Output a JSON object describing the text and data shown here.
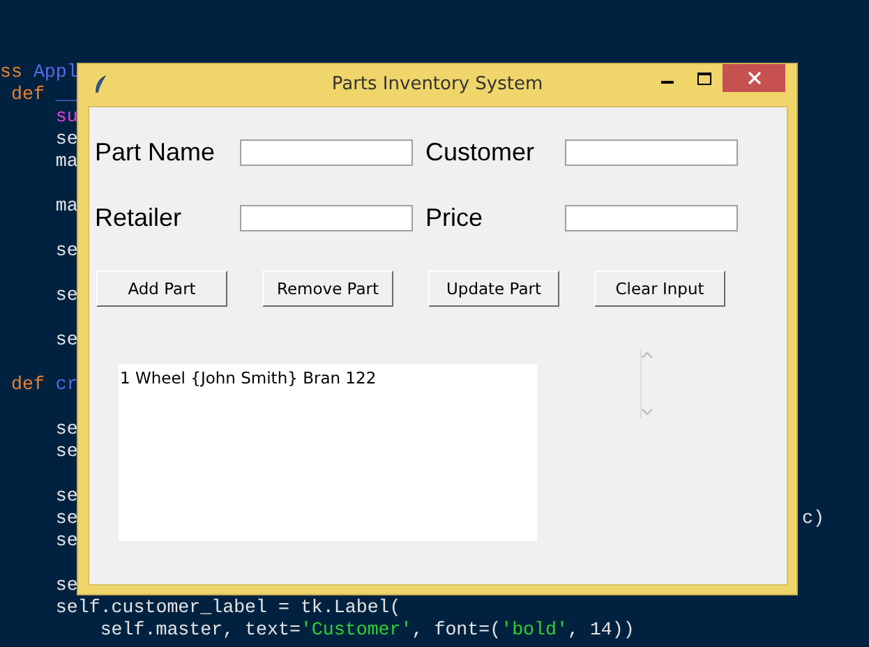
{
  "editor": {
    "lines": [
      {
        "kind": "code",
        "tokens": [
          {
            "kind": "keyword",
            "text": "ss"
          },
          {
            "kind": "name",
            "text": " Appl"
          }
        ]
      },
      {
        "kind": "code",
        "tokens": [
          {
            "kind": "keyword",
            "text": " def"
          },
          {
            "kind": "name",
            "text": " __"
          }
        ]
      },
      {
        "kind": "code",
        "tokens": [
          {
            "kind": "builtin",
            "text": "     su"
          }
        ]
      },
      {
        "kind": "code",
        "tokens": [
          {
            "kind": "plain",
            "text": "     se"
          }
        ]
      },
      {
        "kind": "code",
        "tokens": [
          {
            "kind": "plain",
            "text": "     ma"
          }
        ]
      },
      {
        "kind": "blank"
      },
      {
        "kind": "code",
        "tokens": [
          {
            "kind": "plain",
            "text": "     ma"
          }
        ]
      },
      {
        "kind": "blank"
      },
      {
        "kind": "code",
        "tokens": [
          {
            "kind": "plain",
            "text": "     se"
          }
        ]
      },
      {
        "kind": "blank"
      },
      {
        "kind": "code",
        "tokens": [
          {
            "kind": "plain",
            "text": "     se"
          }
        ]
      },
      {
        "kind": "blank"
      },
      {
        "kind": "code",
        "tokens": [
          {
            "kind": "plain",
            "text": "     se"
          }
        ]
      },
      {
        "kind": "blank"
      },
      {
        "kind": "code",
        "tokens": [
          {
            "kind": "keyword",
            "text": " def"
          },
          {
            "kind": "name",
            "text": " cr"
          }
        ]
      },
      {
        "kind": "blank"
      },
      {
        "kind": "code",
        "tokens": [
          {
            "kind": "plain",
            "text": "     se"
          }
        ]
      },
      {
        "kind": "code",
        "tokens": [
          {
            "kind": "plain",
            "text": "     se"
          }
        ]
      },
      {
        "kind": "blank"
      },
      {
        "kind": "code",
        "tokens": [
          {
            "kind": "plain",
            "text": "     se"
          }
        ]
      },
      {
        "kind": "code",
        "tokens": [
          {
            "kind": "plain",
            "text": "     se"
          }
        ],
        "right": "c)"
      },
      {
        "kind": "code",
        "tokens": [
          {
            "kind": "plain",
            "text": "     se"
          }
        ]
      },
      {
        "kind": "blank"
      },
      {
        "kind": "code",
        "tokens": [
          {
            "kind": "plain",
            "text": "     se"
          }
        ]
      },
      {
        "kind": "code",
        "tokens": [
          {
            "kind": "plain",
            "text": "     self.customer_label = tk.Label("
          }
        ]
      },
      {
        "kind": "code",
        "tokens": [
          {
            "kind": "plain",
            "text": "         self.master, text="
          },
          {
            "kind": "string",
            "text": "'Customer'"
          },
          {
            "kind": "plain",
            "text": ", font=("
          },
          {
            "kind": "string",
            "text": "'bold'"
          },
          {
            "kind": "plain",
            "text": ", 14))"
          }
        ]
      }
    ]
  },
  "window": {
    "title": "Parts Inventory System"
  },
  "fields": [
    {
      "label": "Part Name"
    },
    {
      "label": "Customer"
    },
    {
      "label": "Retailer"
    },
    {
      "label": "Price"
    }
  ],
  "buttons": [
    "Add Part",
    "Remove Part",
    "Update Part",
    "Clear Input"
  ],
  "listbox": {
    "items": [
      "1 Wheel {John Smith} Bran 122"
    ]
  }
}
